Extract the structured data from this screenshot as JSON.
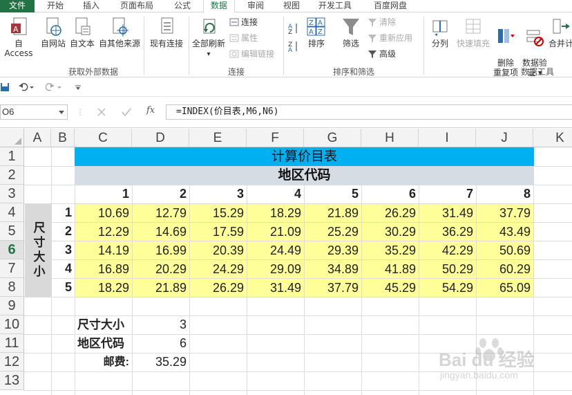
{
  "tabs": [
    "文件",
    "开始",
    "插入",
    "页面布局",
    "公式",
    "数据",
    "审阅",
    "视图",
    "开发工具",
    "百度网盘"
  ],
  "active_tab": "数据",
  "ribbon": {
    "get_external": {
      "buttons": [
        "自 Access",
        "自网站",
        "自文本",
        "自其他来源"
      ],
      "existing": "现有连接",
      "label": "获取外部数据"
    },
    "connections": {
      "refresh_all": "全部刷新",
      "connect": "连接",
      "properties": "属性",
      "edit_links": "编辑链接",
      "label": "连接"
    },
    "sort_filter": {
      "sort": "排序",
      "filter": "筛选",
      "clear": "清除",
      "reapply": "重新应用",
      "advanced": "高级",
      "label": "排序和筛选"
    },
    "data_tools": {
      "split": "分列",
      "flash_fill": "快速填充",
      "remove_dup": "删除\n重复项",
      "validation": "数据验\n证 ▾",
      "consolidate": "合并计",
      "label": "数据工具"
    }
  },
  "name_box": "O6",
  "formula": "=INDEX(价目表,M6,N6)",
  "columns": [
    "A",
    "B",
    "C",
    "D",
    "E",
    "F",
    "G",
    "H",
    "I",
    "J",
    "K"
  ],
  "rows": [
    "1",
    "2",
    "3",
    "4",
    "5",
    "6",
    "7",
    "8",
    "9",
    "10",
    "11",
    "12",
    "13"
  ],
  "selected_row": "6",
  "sheet": {
    "title": "计算价目表",
    "subtitle": "地区代码",
    "region_codes": [
      "1",
      "2",
      "3",
      "4",
      "5",
      "6",
      "7",
      "8"
    ],
    "size_label": "尺寸大小",
    "size_codes": [
      "1",
      "2",
      "3",
      "4",
      "5"
    ],
    "table": [
      [
        "10.69",
        "12.79",
        "15.29",
        "18.29",
        "21.89",
        "26.29",
        "31.49",
        "37.79"
      ],
      [
        "12.29",
        "14.69",
        "17.59",
        "21.09",
        "25.29",
        "30.29",
        "36.29",
        "43.49"
      ],
      [
        "14.19",
        "16.99",
        "20.39",
        "24.49",
        "29.39",
        "35.29",
        "42.29",
        "50.69"
      ],
      [
        "16.89",
        "20.29",
        "24.29",
        "29.09",
        "34.89",
        "41.89",
        "50.29",
        "60.29"
      ],
      [
        "18.29",
        "21.89",
        "26.29",
        "31.49",
        "37.79",
        "45.29",
        "54.29",
        "65.09"
      ]
    ],
    "lookup": [
      {
        "label": "尺寸大小",
        "value": "3"
      },
      {
        "label": "地区代码",
        "value": "6"
      },
      {
        "label": "邮费:",
        "value": "35.29"
      }
    ]
  },
  "watermark": {
    "brand": "Bai du 经验",
    "url": "jingyan.baidu.com"
  },
  "colors": {
    "accent": "#217346",
    "title_bg": "#00b0f0",
    "subtitle_bg": "#d6dce4",
    "table_bg": "#ffff99",
    "size_bg": "#d9d9d9"
  }
}
